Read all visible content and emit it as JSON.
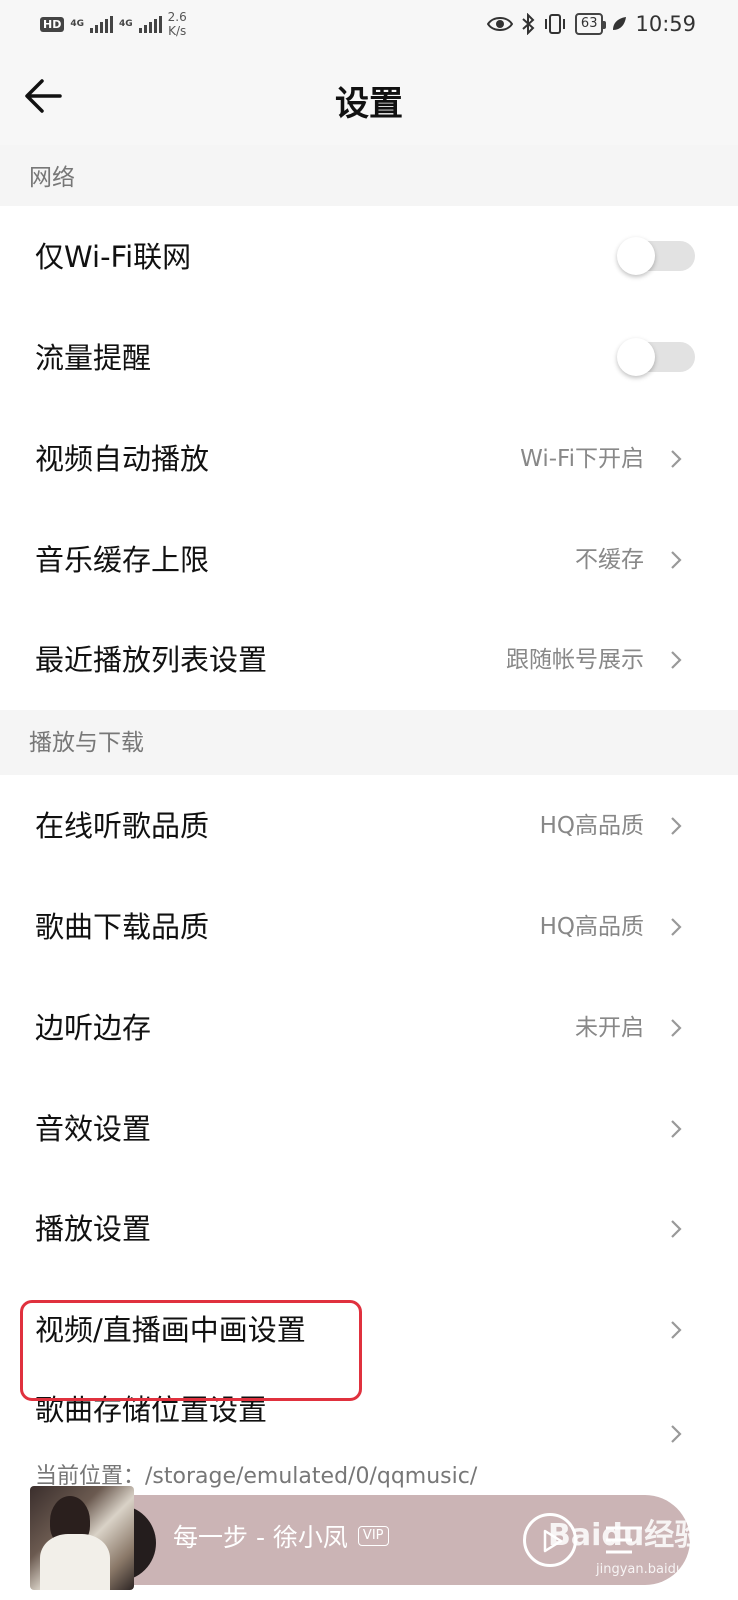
{
  "status_bar": {
    "hd": "HD",
    "sim_tag_1": "4G",
    "sim_tag_2": "4G",
    "speed_value": "2.6",
    "speed_unit": "K/s",
    "battery": "63",
    "time": "10:59"
  },
  "header": {
    "title": "设置"
  },
  "sections": {
    "network": {
      "title": "网络",
      "rows": [
        {
          "label": "仅Wi-Fi联网",
          "toggle": false
        },
        {
          "label": "流量提醒",
          "toggle": false
        },
        {
          "label": "视频自动播放",
          "value": "Wi-Fi下开启"
        },
        {
          "label": "音乐缓存上限",
          "value": "不缓存"
        },
        {
          "label": "最近播放列表设置",
          "value": "跟随帐号展示"
        }
      ]
    },
    "playback": {
      "title": "播放与下载",
      "rows": [
        {
          "label": "在线听歌品质",
          "value": "HQ高品质"
        },
        {
          "label": "歌曲下载品质",
          "value": "HQ高品质"
        },
        {
          "label": "边听边存",
          "value": "未开启"
        },
        {
          "label": "音效设置"
        },
        {
          "label": "播放设置"
        },
        {
          "label": "视频/直播画中画设置"
        },
        {
          "label": "歌曲存储位置设置",
          "sub": "当前位置：/storage/emulated/0/qqmusic/"
        }
      ]
    }
  },
  "player": {
    "song": "每一步 - 徐小凤",
    "vip": "VIP"
  },
  "watermark": {
    "main": "Baidu经验",
    "sub": "jingyan.baidu.com"
  },
  "colors": {
    "highlight": "#e0313e",
    "player_bg": "#cbb4b5",
    "toggle_off": "#e2e2e2"
  }
}
